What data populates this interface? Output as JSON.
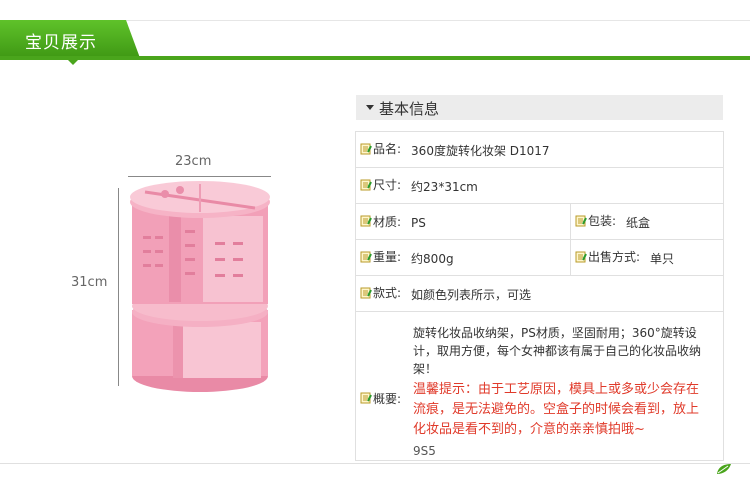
{
  "header": {
    "tab_title": "宝贝展示"
  },
  "product_image": {
    "width_label": "23cm",
    "height_label": "31cm"
  },
  "info": {
    "section_title": "基本信息",
    "name_label": "品名:",
    "name_value": "360度旋转化妆架 D1017",
    "size_label": "尺寸:",
    "size_value": "约23*31cm",
    "material_label": "材质:",
    "material_value": "PS",
    "packing_label": "包装:",
    "packing_value": "纸盒",
    "weight_label": "重量:",
    "weight_value": "约800g",
    "sale_label": "出售方式:",
    "sale_value": "单只",
    "style_label": "款式:",
    "style_value": "如颜色列表所示，可选",
    "summary_label": "概要:",
    "summary_value": "旋转化妆品收纳架，PS材质，坚固耐用；360°旋转设计，取用方便，每个女神都该有属于自己的化妆品收纳架！",
    "warning_text": "温馨提示：由于工艺原因，模具上或多或少会存在流痕，是无法避免的。空盒子的时候会看到，放上化妆品是看不到的，介意的亲亲慎拍哦~",
    "code": "9S5"
  },
  "colors": {
    "accent_green": "#4aa51c",
    "warning_red": "#e03a2a",
    "product_pink": "#f4a6bd"
  },
  "icons": {
    "row_icon": "note-edit-icon",
    "corner_icon": "leaf-icon"
  }
}
